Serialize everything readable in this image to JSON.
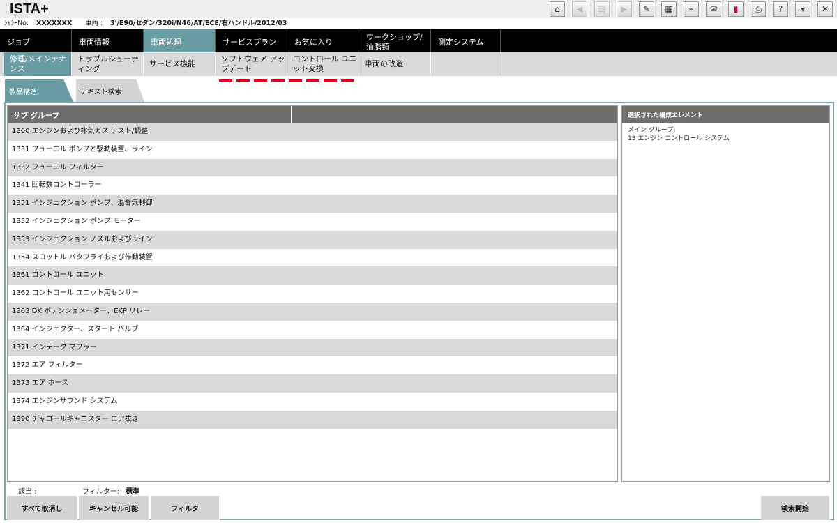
{
  "app": {
    "title": "ISTA+"
  },
  "toolbar": {
    "icons": [
      {
        "name": "home-icon",
        "glyph": "⌂"
      },
      {
        "name": "back-icon",
        "glyph": "◀"
      },
      {
        "name": "copy-icon",
        "glyph": "▤"
      },
      {
        "name": "forward-icon",
        "glyph": "▶"
      },
      {
        "name": "wrench-icon",
        "glyph": "✎"
      },
      {
        "name": "info-icon",
        "glyph": "▦"
      },
      {
        "name": "connection-icon",
        "glyph": "⌁"
      },
      {
        "name": "mail-icon",
        "glyph": "✉"
      },
      {
        "name": "battery-icon",
        "glyph": "▮"
      },
      {
        "name": "print-icon",
        "glyph": "⎙"
      },
      {
        "name": "help-icon",
        "glyph": "?"
      },
      {
        "name": "minimize-icon",
        "glyph": "▾"
      },
      {
        "name": "close-icon",
        "glyph": "✕"
      }
    ]
  },
  "vehicle": {
    "vin_label": "ｼｬｼｰNo:",
    "vin_value": "XXXXXXX",
    "vehicle_label": "車両 :",
    "vehicle_value": "3'/E90/セダン/320i/N46/AT/ECE/右ハンドル/2012/03"
  },
  "mainnav": [
    {
      "label": "ジョブ"
    },
    {
      "label": "車両情報"
    },
    {
      "label": "車両処理"
    },
    {
      "label": "サービスプラン"
    },
    {
      "label": "お気に入り"
    },
    {
      "label": "ワークショップ/ 油脂類"
    },
    {
      "label": "測定システム"
    }
  ],
  "subnav": [
    {
      "label": "修理/メインテナンス"
    },
    {
      "label": "トラブルシューティング"
    },
    {
      "label": "サービス機能"
    },
    {
      "label": "ソフトウェア アップデート"
    },
    {
      "label": "コントロール ユニット交換"
    },
    {
      "label": "車両の改造"
    }
  ],
  "tabs": {
    "product": "製品構造",
    "text_search": "テキスト検索"
  },
  "list": {
    "header": "サブ グループ",
    "rows": [
      "1300 エンジンおよび排気ガス テスト/調整",
      "1331 フューエル ポンプと駆動装置、ライン",
      "1332 フューエル フィルター",
      "1341 回転数コントローラー",
      "1351 インジェクション ポンプ、混合気制御",
      "1352 インジェクション ポンプ モーター",
      "1353 インジェクション ノズルおよびライン",
      "1354 スロットル バタフライおよび作動装置",
      "1361 コントロール ユニット",
      "1362 コントロール ユニット用センサー",
      "1363 DK ポテンショメーター、EKP リレー",
      "1364 インジェクター、スタート バルブ",
      "1371 インテーク マフラー",
      "1372 エア フィルター",
      "1373 エア ホース",
      "1374 エンジンサウンド システム",
      "1390 チャコールキャニスター エア抜き"
    ]
  },
  "selected": {
    "header": "選択された構成エレメント",
    "main_group_label": "メイン グループ:",
    "main_group_value": "13 エンジン コントロール システム"
  },
  "footer": {
    "match_label": "該当 :",
    "filter_label": "フィルター:",
    "filter_value": "標準",
    "clear_all": "すべて取消し",
    "cancelable": "キャンセル可能",
    "filter_button": "フィルタ",
    "search_start": "検索開始"
  }
}
